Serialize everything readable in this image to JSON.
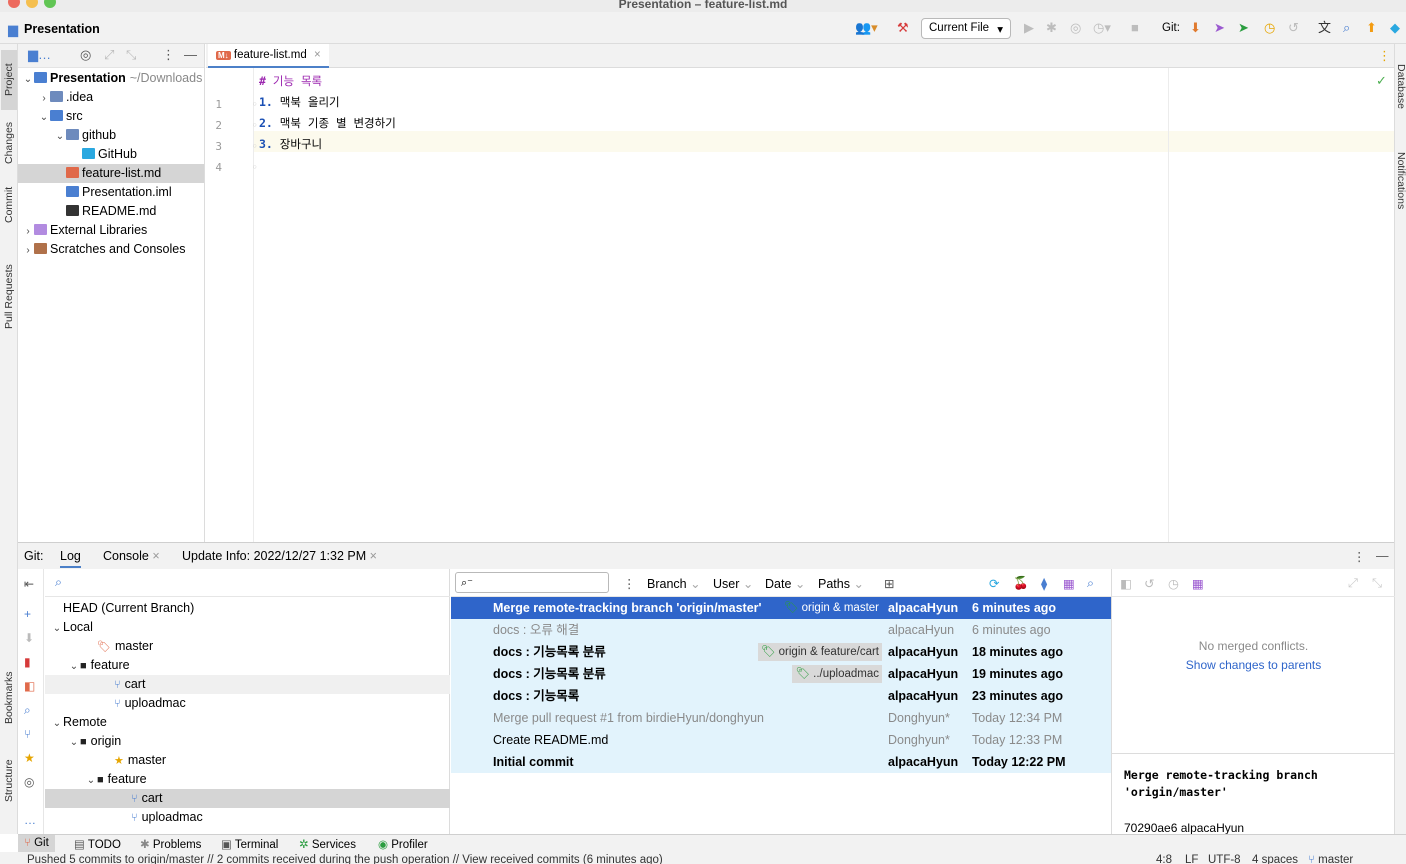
{
  "window": {
    "title": "Presentation – feature-list.md"
  },
  "toolbar": {
    "project_name": "Presentation",
    "run_config": "Current File",
    "git_label": "Git:"
  },
  "left_strip": {
    "project": "Project",
    "changes": "Changes",
    "commit": "Commit",
    "pull_requests": "Pull Requests",
    "bookmarks": "Bookmarks",
    "structure": "Structure"
  },
  "right_strip": {
    "database": "Database",
    "notifications": "Notifications"
  },
  "project_tree": [
    {
      "label": "Presentation",
      "suffix": "~/Downloads",
      "indent": 0,
      "arrow": "⌄",
      "icon": "folder-module-icon",
      "bold": true
    },
    {
      "label": ".idea",
      "indent": 1,
      "arrow": "›",
      "icon": "folder-icon"
    },
    {
      "label": "src",
      "indent": 1,
      "arrow": "⌄",
      "icon": "folder-src-icon"
    },
    {
      "label": "github",
      "indent": 2,
      "arrow": "⌄",
      "icon": "folder-icon"
    },
    {
      "label": "GitHub",
      "indent": 3,
      "arrow": "",
      "icon": "github-icon"
    },
    {
      "label": "feature-list.md",
      "indent": 2,
      "arrow": "",
      "icon": "markdown-icon",
      "selected": true
    },
    {
      "label": "Presentation.iml",
      "indent": 2,
      "arrow": "",
      "icon": "iml-icon"
    },
    {
      "label": "README.md",
      "indent": 2,
      "arrow": "",
      "icon": "readme-icon"
    },
    {
      "label": "External Libraries",
      "indent": 0,
      "arrow": "›",
      "icon": "libraries-icon"
    },
    {
      "label": "Scratches and Consoles",
      "indent": 0,
      "arrow": "›",
      "icon": "scratches-icon"
    }
  ],
  "editor": {
    "tab_label": "feature-list.md",
    "lines": [
      {
        "num": "1",
        "marker": "#",
        "text": " 기능 목록"
      },
      {
        "num": "2",
        "marker": "1.",
        "text": " 맥북 올리기"
      },
      {
        "num": "3",
        "marker": "2.",
        "text": " 맥북 기종 별 변경하기"
      },
      {
        "num": "4",
        "marker": "3.",
        "text": " 장바구니"
      }
    ]
  },
  "git_panel": {
    "label": "Git:",
    "tabs": [
      "Log",
      "Console",
      "Update Info: 2022/12/27 1:32 PM"
    ],
    "branches": [
      {
        "label": "HEAD (Current Branch)",
        "indent": 0,
        "arrow": "",
        "icon": "none"
      },
      {
        "label": "Local",
        "indent": 0,
        "arrow": "⌄",
        "icon": "none"
      },
      {
        "label": "master",
        "indent": 2,
        "arrow": "",
        "icon": "tag-icon"
      },
      {
        "label": "feature",
        "indent": 1,
        "arrow": "⌄",
        "icon": "folder-icon"
      },
      {
        "label": "cart",
        "indent": 3,
        "arrow": "",
        "icon": "branch-icon"
      },
      {
        "label": "uploadmac",
        "indent": 3,
        "arrow": "",
        "icon": "branch-icon"
      },
      {
        "label": "Remote",
        "indent": 0,
        "arrow": "⌄",
        "icon": "none"
      },
      {
        "label": "origin",
        "indent": 1,
        "arrow": "⌄",
        "icon": "folder-icon"
      },
      {
        "label": "master",
        "indent": 3,
        "arrow": "",
        "icon": "star-icon"
      },
      {
        "label": "feature",
        "indent": 2,
        "arrow": "⌄",
        "icon": "folder-icon"
      },
      {
        "label": "cart",
        "indent": 4,
        "arrow": "",
        "icon": "branch-icon"
      },
      {
        "label": "uploadmac",
        "indent": 4,
        "arrow": "",
        "icon": "branch-icon"
      }
    ],
    "filters": [
      "Branch",
      "User",
      "Date",
      "Paths"
    ],
    "commits": [
      {
        "message": "Merge remote-tracking branch 'origin/master'",
        "tag": "origin & master",
        "author": "alpacaHyun",
        "date": "6 minutes ago",
        "bold": true,
        "selected": true
      },
      {
        "message": "docs : 오류 해결",
        "tag": "",
        "author": "alpacaHyun",
        "date": "6 minutes ago",
        "bold": false
      },
      {
        "message": "docs : 기능목록 분류",
        "tag": "origin & feature/cart",
        "author": "alpacaHyun",
        "date": "18 minutes ago",
        "bold": true
      },
      {
        "message": "docs : 기능목록 분류",
        "tag": "../uploadmac",
        "author": "alpacaHyun",
        "date": "19 minutes ago",
        "bold": true
      },
      {
        "message": "docs : 기능목록",
        "tag": "",
        "author": "alpacaHyun",
        "date": "23 minutes ago",
        "bold": true
      },
      {
        "message": "Merge pull request #1 from birdieHyun/donghyun",
        "tag": "",
        "author": "Donghyun*",
        "date": "Today 12:34 PM",
        "bold": false
      },
      {
        "message": "Create README.md",
        "tag": "",
        "author": "Donghyun*",
        "date": "Today 12:33 PM",
        "bold": false,
        "dark": true
      },
      {
        "message": "Initial commit",
        "tag": "",
        "author": "alpacaHyun",
        "date": "Today 12:22 PM",
        "bold": true
      }
    ],
    "details": {
      "no_conflicts": "No merged conflicts.",
      "show_changes": "Show changes to parents",
      "commit_message": "Merge remote-tracking branch\n'origin/master'",
      "hash_author": "70290ae6 alpacaHyun"
    }
  },
  "bottom_tabs": [
    "Git",
    "TODO",
    "Problems",
    "Terminal",
    "Services",
    "Profiler"
  ],
  "status": {
    "message": "Pushed 5 commits to origin/master // 2 commits received during the push operation // View received commits (6 minutes ago)",
    "position": "4:8",
    "line_sep": "LF",
    "encoding": "UTF-8",
    "indent": "4 spaces",
    "branch": "master"
  },
  "colors": {
    "accent": "#2f65ca",
    "link": "#2f65ca",
    "md_icon": "#e0694a",
    "selection": "#2f65ca",
    "commit_row_bg": "#e2f3fc"
  }
}
